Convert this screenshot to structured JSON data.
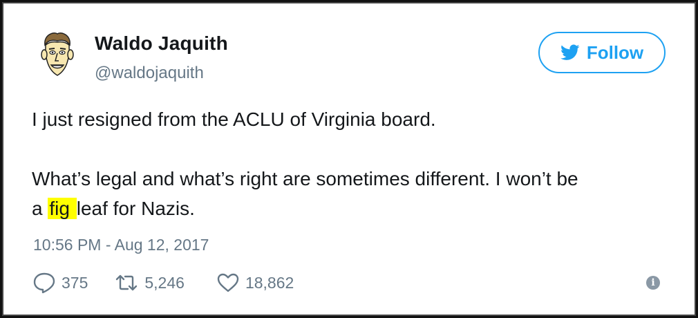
{
  "author": {
    "display_name": "Waldo Jaquith",
    "handle": "@waldojaquith",
    "avatar_icon": "cartoon-face-avatar"
  },
  "follow_button": {
    "label": "Follow",
    "icon": "bird-icon",
    "color": "#1da1f2"
  },
  "tweet": {
    "line1": "I just resigned from the ACLU of Virginia board.",
    "line2": "What’s legal and what’s right are sometimes different. I won’t be",
    "line3_pre": "a ",
    "line3_highlight": "fig ",
    "line3_post": "leaf for Nazis.",
    "highlight_color": "#ffff00"
  },
  "timestamp": "10:56 PM - Aug 12, 2017",
  "actions": {
    "replies": "375",
    "retweets": "5,246",
    "likes": "18,862"
  },
  "colors": {
    "text": "#14171a",
    "muted": "#657786",
    "accent": "#1da1f2"
  }
}
